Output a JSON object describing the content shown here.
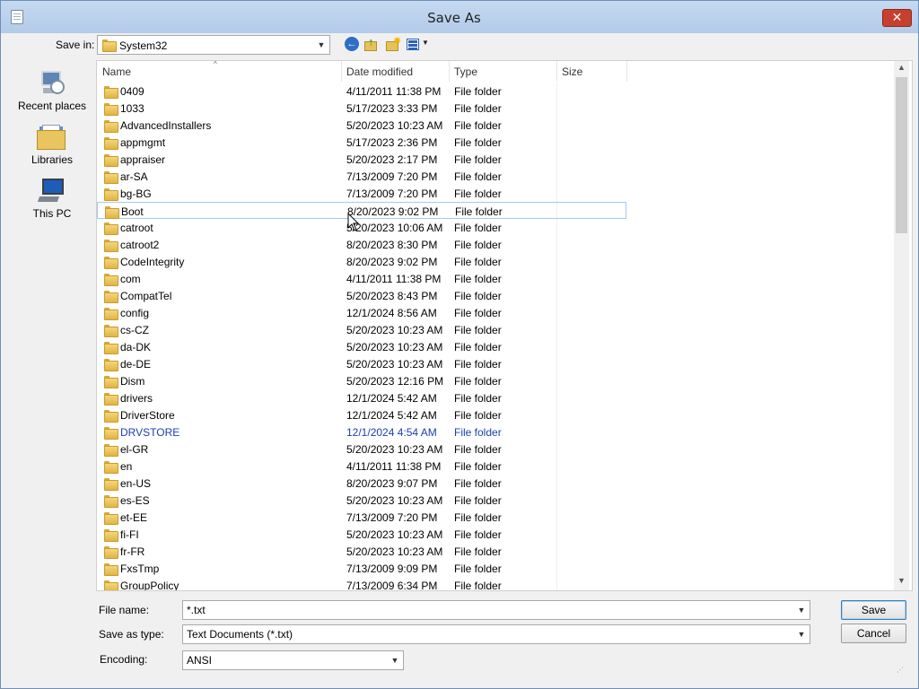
{
  "window": {
    "title": "Save As",
    "close_label": "✕"
  },
  "save_in": {
    "label": "Save in:",
    "value": "System32"
  },
  "places": [
    {
      "label": "Recent places"
    },
    {
      "label": "Libraries"
    },
    {
      "label": "This PC"
    }
  ],
  "columns": {
    "name": "Name",
    "date": "Date modified",
    "type": "Type",
    "size": "Size"
  },
  "files": [
    {
      "name": "0409",
      "date": "4/11/2011 11:38 PM",
      "type": "File folder"
    },
    {
      "name": "1033",
      "date": "5/17/2023 3:33 PM",
      "type": "File folder"
    },
    {
      "name": "AdvancedInstallers",
      "date": "5/20/2023 10:23 AM",
      "type": "File folder"
    },
    {
      "name": "appmgmt",
      "date": "5/17/2023 2:36 PM",
      "type": "File folder"
    },
    {
      "name": "appraiser",
      "date": "5/20/2023 2:17 PM",
      "type": "File folder"
    },
    {
      "name": "ar-SA",
      "date": "7/13/2009 7:20 PM",
      "type": "File folder"
    },
    {
      "name": "bg-BG",
      "date": "7/13/2009 7:20 PM",
      "type": "File folder"
    },
    {
      "name": "Boot",
      "date": "8/20/2023 9:02 PM",
      "type": "File folder"
    },
    {
      "name": "catroot",
      "date": "5/20/2023 10:06 AM",
      "type": "File folder"
    },
    {
      "name": "catroot2",
      "date": "8/20/2023 8:30 PM",
      "type": "File folder"
    },
    {
      "name": "CodeIntegrity",
      "date": "8/20/2023 9:02 PM",
      "type": "File folder"
    },
    {
      "name": "com",
      "date": "4/11/2011 11:38 PM",
      "type": "File folder"
    },
    {
      "name": "CompatTel",
      "date": "5/20/2023 8:43 PM",
      "type": "File folder"
    },
    {
      "name": "config",
      "date": "12/1/2024 8:56 AM",
      "type": "File folder"
    },
    {
      "name": "cs-CZ",
      "date": "5/20/2023 10:23 AM",
      "type": "File folder"
    },
    {
      "name": "da-DK",
      "date": "5/20/2023 10:23 AM",
      "type": "File folder"
    },
    {
      "name": "de-DE",
      "date": "5/20/2023 10:23 AM",
      "type": "File folder"
    },
    {
      "name": "Dism",
      "date": "5/20/2023 12:16 PM",
      "type": "File folder"
    },
    {
      "name": "drivers",
      "date": "12/1/2024 5:42 AM",
      "type": "File folder"
    },
    {
      "name": "DriverStore",
      "date": "12/1/2024 5:42 AM",
      "type": "File folder"
    },
    {
      "name": "DRVSTORE",
      "date": "12/1/2024 4:54 AM",
      "type": "File folder"
    },
    {
      "name": "el-GR",
      "date": "5/20/2023 10:23 AM",
      "type": "File folder"
    },
    {
      "name": "en",
      "date": "4/11/2011 11:38 PM",
      "type": "File folder"
    },
    {
      "name": "en-US",
      "date": "8/20/2023 9:07 PM",
      "type": "File folder"
    },
    {
      "name": "es-ES",
      "date": "5/20/2023 10:23 AM",
      "type": "File folder"
    },
    {
      "name": "et-EE",
      "date": "7/13/2009 7:20 PM",
      "type": "File folder"
    },
    {
      "name": "fi-FI",
      "date": "5/20/2023 10:23 AM",
      "type": "File folder"
    },
    {
      "name": "fr-FR",
      "date": "5/20/2023 10:23 AM",
      "type": "File folder"
    },
    {
      "name": "FxsTmp",
      "date": "7/13/2009 9:09 PM",
      "type": "File folder"
    },
    {
      "name": "GroupPolicy",
      "date": "7/13/2009 6:34 PM",
      "type": "File folder"
    }
  ],
  "file_name": {
    "label": "File name:",
    "value": "*.txt"
  },
  "save_as_type": {
    "label": "Save as type:",
    "value": "Text Documents (*.txt)"
  },
  "encoding": {
    "label": "Encoding:",
    "value": "ANSI"
  },
  "buttons": {
    "save": "Save",
    "cancel": "Cancel"
  },
  "icons": {
    "back": "back-arrow-icon",
    "up": "up-folder-icon",
    "new_folder": "new-folder-icon",
    "view": "view-menu-icon",
    "folder": "folder-icon"
  },
  "colors": {
    "selected_text": "#1a3fb0",
    "close_button": "#c7402d",
    "titlebar": "#b9d1ee"
  }
}
